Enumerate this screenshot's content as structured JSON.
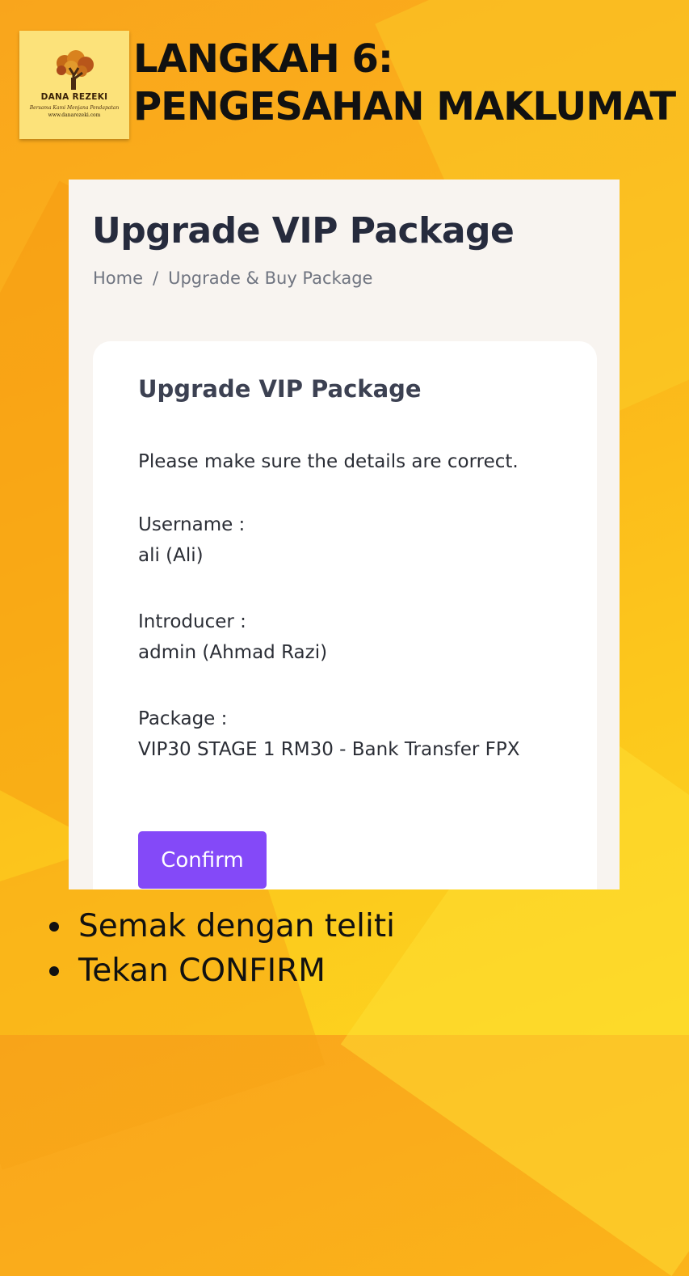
{
  "logo": {
    "name": "DANA REZEKI",
    "tagline": "Bersama Kami Menjana Pendapatan",
    "url": "www.danarezeki.com"
  },
  "headline": "LANGKAH 6: PENGESAHAN MAKLUMAT",
  "screen": {
    "page_title": "Upgrade VIP Package",
    "breadcrumb": {
      "home": "Home",
      "separator": "/",
      "current": "Upgrade & Buy Package"
    },
    "card": {
      "title": "Upgrade VIP Package",
      "instruction": "Please make sure the details are correct.",
      "username_label": "Username :",
      "username_value": "ali (Ali)",
      "introducer_label": "Introducer :",
      "introducer_value": "admin (Ahmad Razi)",
      "package_label": "Package :",
      "package_value": "VIP30 STAGE 1 RM30 - Bank Transfer FPX",
      "confirm_label": "Confirm"
    }
  },
  "bullets": [
    "Semak dengan teliti",
    "Tekan CONFIRM"
  ],
  "colors": {
    "background": "#fbb21a",
    "button": "#8449f8",
    "title": "#262b3d"
  }
}
